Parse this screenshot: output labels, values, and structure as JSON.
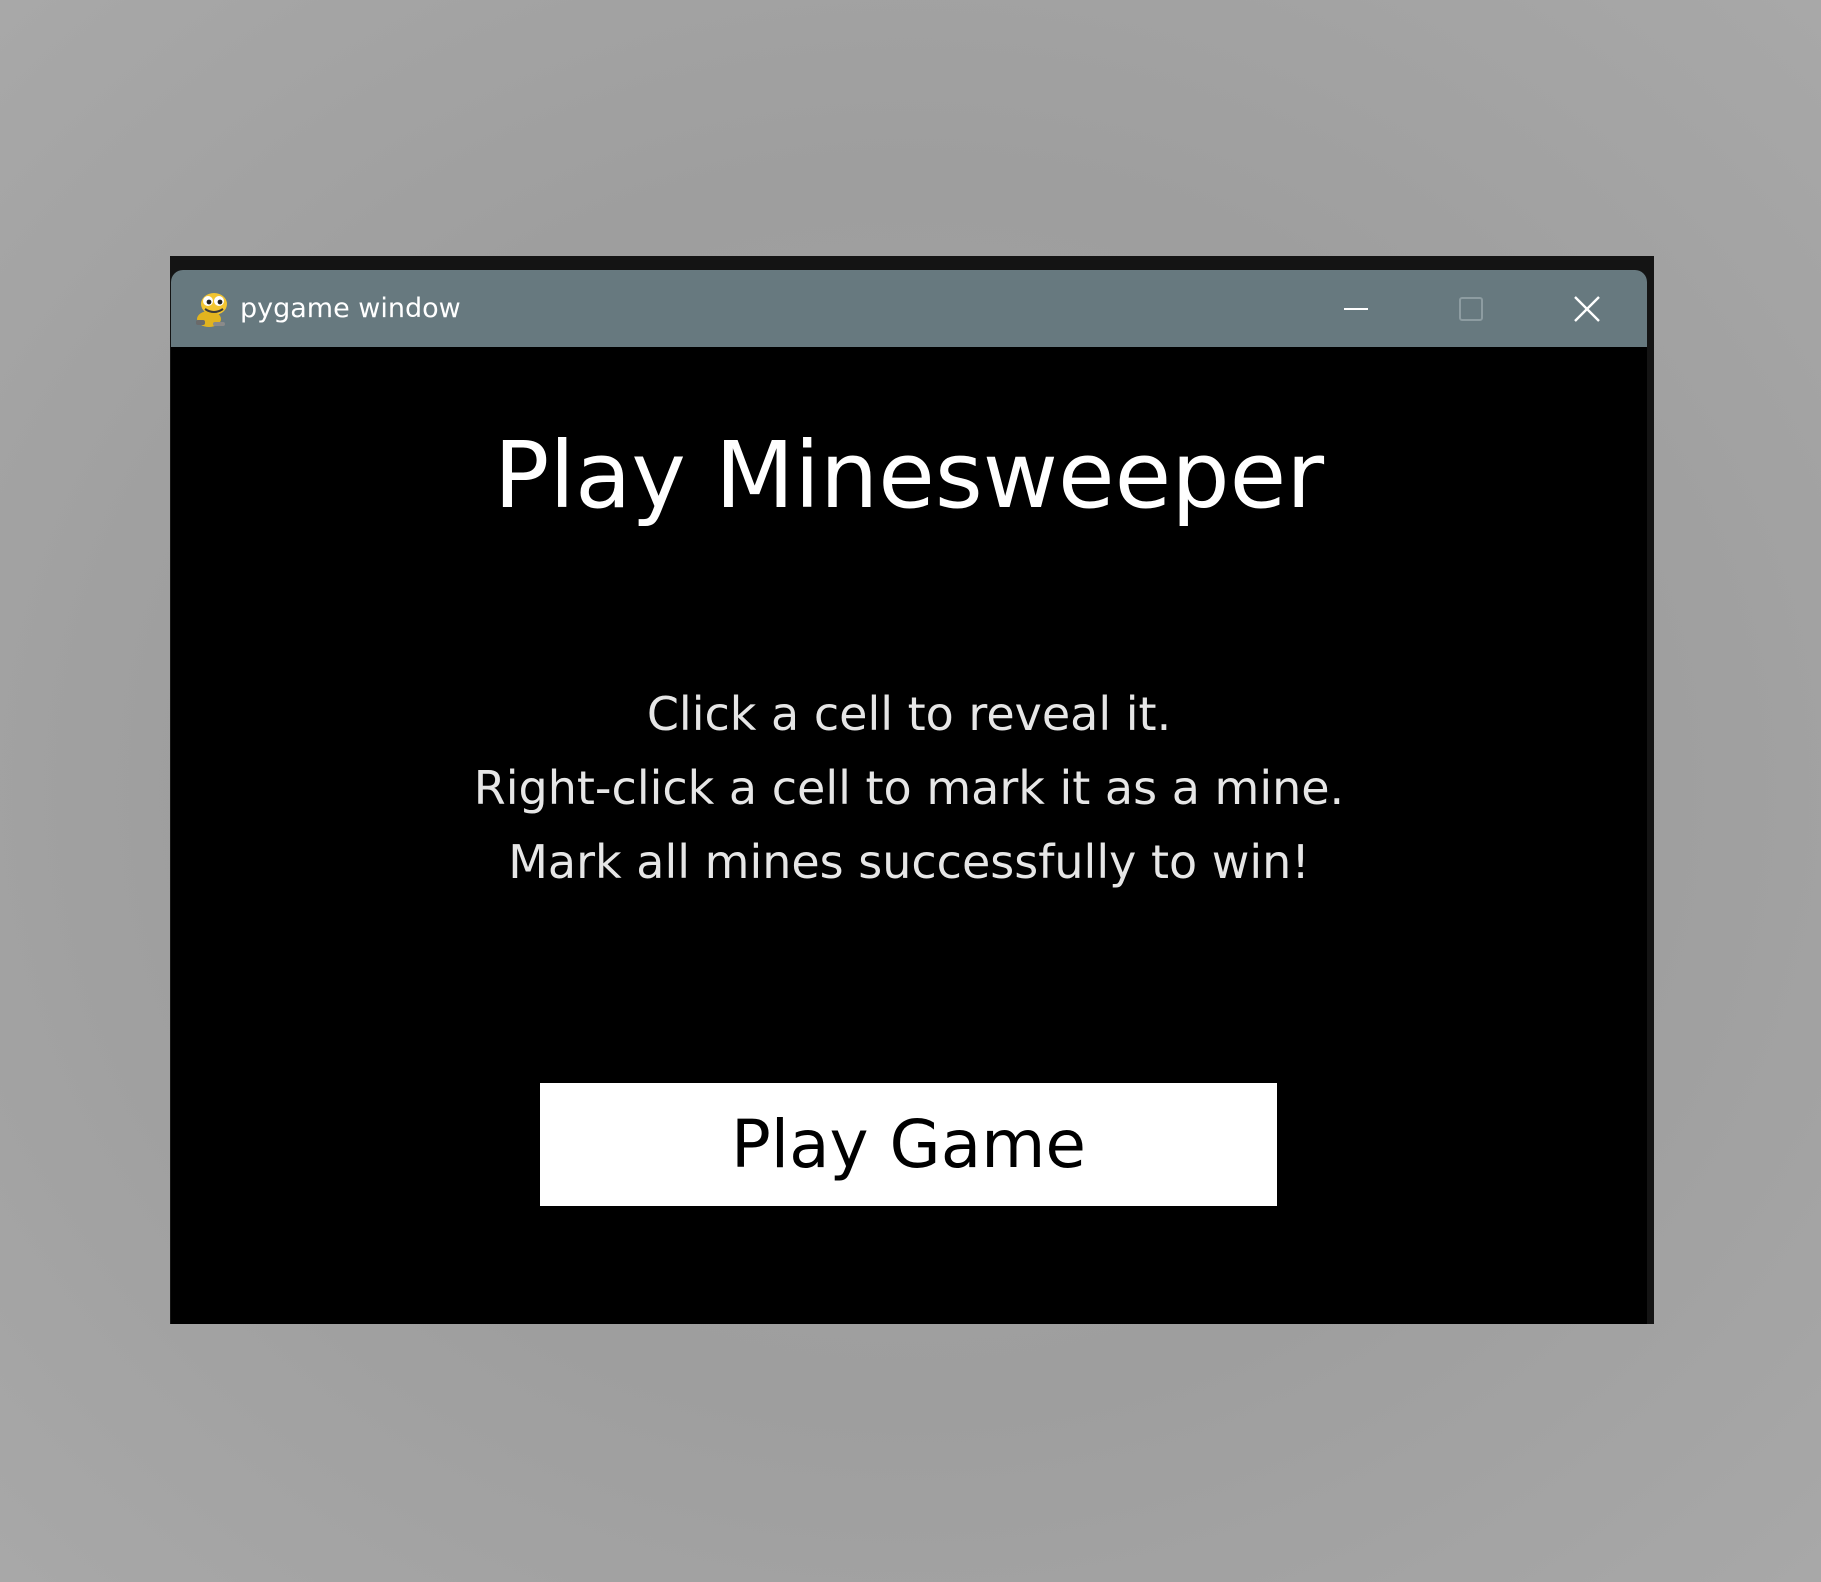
{
  "window": {
    "title": "pygame window",
    "app_icon": "pygame-snake-icon",
    "controls": {
      "minimize_icon": "minimize-icon",
      "maximize_icon": "maximize-icon",
      "close_icon": "close-icon"
    },
    "colors": {
      "titlebar": "#67797f",
      "background": "#000000",
      "text": "#ffffff"
    }
  },
  "screen": {
    "heading": "Play Minesweeper",
    "instructions": [
      "Click a cell to reveal it.",
      "Right-click a cell to mark it as a mine.",
      "Mark all mines successfully to win!"
    ],
    "play_button_label": "Play Game",
    "play_button_color": "#ffffff"
  }
}
